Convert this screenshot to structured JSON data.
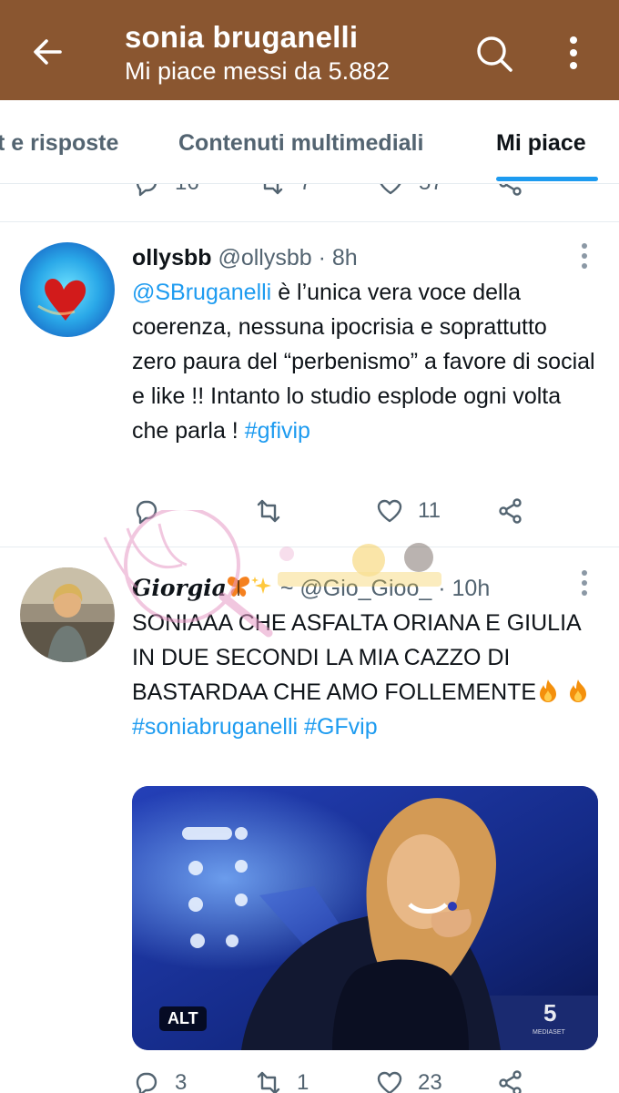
{
  "header": {
    "title": "sonia bruganelli",
    "subtitle": "Mi piace messi da 5.882"
  },
  "tabs": [
    {
      "label": "t e risposte",
      "active": false
    },
    {
      "label": "Contenuti multimediali",
      "active": false
    },
    {
      "label": "Mi piace",
      "active": true
    }
  ],
  "partial_stats": {
    "replies": "16",
    "retweets": "7",
    "likes": "57"
  },
  "tweets": [
    {
      "display_name": "ollysbb",
      "handle": "@ollysbb",
      "separator": "·",
      "time": "8h",
      "mention": "@SBruganelli",
      "text_1": " è l’unica vera voce della coerenza, nessuna  ipocrisia e soprattutto zero  paura  del “perbenismo” a favore di social e like !! Intanto lo studio esplode ogni volta che parla ! ",
      "hashtag": "#gfivip",
      "stats": {
        "replies": "",
        "retweets": "",
        "likes": "11"
      }
    },
    {
      "display_name": "Giorgia",
      "name_suffix": " ~",
      "handle": "@Gio_Gioo_",
      "separator": "·",
      "time": "10h",
      "text_1": "SONIAAA CHE ASFALTA ORIANA E GIULIA IN DUE SECONDI LA MIA CAZZO DI BASTARDAA CHE AMO FOLLEMENTE",
      "hashtag_1": "#soniabruganelli",
      "hashtag_2": "#GFvip",
      "media_badge": "ALT",
      "stats": {
        "replies": "3",
        "retweets": "1",
        "likes": "23"
      }
    }
  ],
  "colors": {
    "header": "#8a5630",
    "accent": "#1d9bf0",
    "muted": "#536471"
  }
}
